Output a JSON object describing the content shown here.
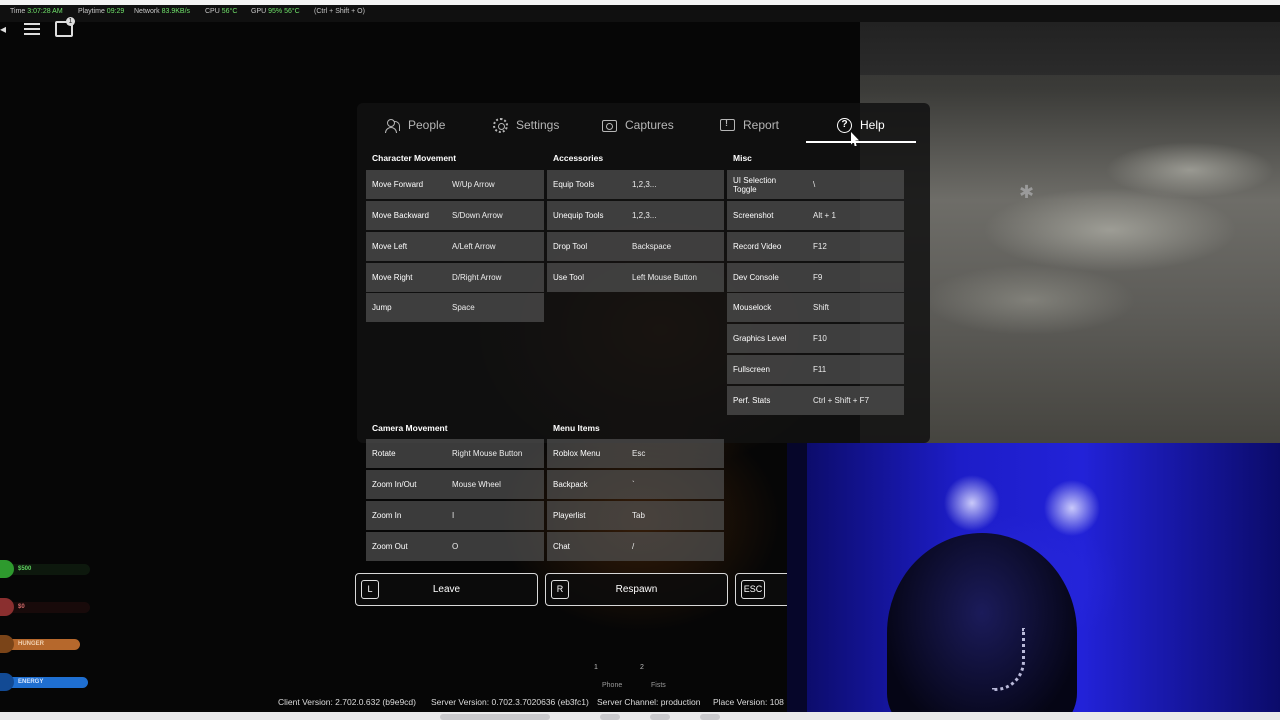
{
  "stats": {
    "time_label": "Time",
    "time": "3:07:28 AM",
    "playtime_label": "Playtime",
    "playtime": "09:29",
    "network_label": "Network",
    "network": "83.9KB/s",
    "cpu_label": "CPU",
    "cpu": "56°C",
    "gpu_label": "GPU",
    "gpu": "95%",
    "gpu_temp": "56°C",
    "shortcut": "(Ctrl + Shift + O)"
  },
  "chat_badge": "1",
  "tabs": [
    {
      "label": "People",
      "icon": "people-icon"
    },
    {
      "label": "Settings",
      "icon": "gear-icon"
    },
    {
      "label": "Captures",
      "icon": "camera-icon"
    },
    {
      "label": "Report",
      "icon": "report-icon"
    },
    {
      "label": "Help",
      "icon": "help-icon",
      "active": true
    }
  ],
  "sections": {
    "character_movement": {
      "title": "Character Movement",
      "rows": [
        {
          "action": "Move Forward",
          "key": "W/Up Arrow"
        },
        {
          "action": "Move Backward",
          "key": "S/Down Arrow"
        },
        {
          "action": "Move Left",
          "key": "A/Left Arrow"
        },
        {
          "action": "Move Right",
          "key": "D/Right Arrow"
        },
        {
          "action": "Jump",
          "key": "Space"
        }
      ]
    },
    "accessories": {
      "title": "Accessories",
      "rows": [
        {
          "action": "Equip Tools",
          "key": "1,2,3..."
        },
        {
          "action": "Unequip Tools",
          "key": "1,2,3..."
        },
        {
          "action": "Drop Tool",
          "key": "Backspace"
        },
        {
          "action": "Use Tool",
          "key": "Left Mouse Button"
        }
      ]
    },
    "misc": {
      "title": "Misc",
      "rows": [
        {
          "action": "UI Selection Toggle",
          "key": "\\"
        },
        {
          "action": "Screenshot",
          "key": "Alt + 1"
        },
        {
          "action": "Record Video",
          "key": "F12"
        },
        {
          "action": "Dev Console",
          "key": "F9"
        },
        {
          "action": "Mouselock",
          "key": "Shift"
        },
        {
          "action": "Graphics Level",
          "key": "F10"
        },
        {
          "action": "Fullscreen",
          "key": "F11"
        },
        {
          "action": "Perf. Stats",
          "key": "Ctrl + Shift + F7"
        }
      ]
    },
    "camera_movement": {
      "title": "Camera Movement",
      "rows": [
        {
          "action": "Rotate",
          "key": "Right Mouse Button"
        },
        {
          "action": "Zoom In/Out",
          "key": "Mouse Wheel"
        },
        {
          "action": "Zoom In",
          "key": "I"
        },
        {
          "action": "Zoom Out",
          "key": "O"
        }
      ]
    },
    "menu_items": {
      "title": "Menu Items",
      "rows": [
        {
          "action": "Roblox Menu",
          "key": "Esc"
        },
        {
          "action": "Backpack",
          "key": "`"
        },
        {
          "action": "Playerlist",
          "key": "Tab"
        },
        {
          "action": "Chat",
          "key": "/"
        }
      ]
    }
  },
  "buttons": [
    {
      "key": "L",
      "label": "Leave"
    },
    {
      "key": "R",
      "label": "Respawn"
    },
    {
      "key": "ESC",
      "label": ""
    }
  ],
  "hud": [
    {
      "label": "$500",
      "color": "#2e9a2e"
    },
    {
      "label": "$0",
      "color": "#8a2f2f"
    },
    {
      "label": "HUNGER",
      "color": "#b6682c"
    },
    {
      "label": "ENERGY",
      "color": "#1f6fd1"
    }
  ],
  "hotbar": [
    {
      "slot": "1",
      "name": "Phone"
    },
    {
      "slot": "2",
      "name": "Fists"
    }
  ],
  "versions": {
    "client": "Client Version: 2.702.0.632 (b9e9cd)",
    "server": "Server Version: 0.702.3.7020636 (eb3fc1)",
    "channel": "Server Channel: production",
    "place": "Place Version: 108"
  }
}
